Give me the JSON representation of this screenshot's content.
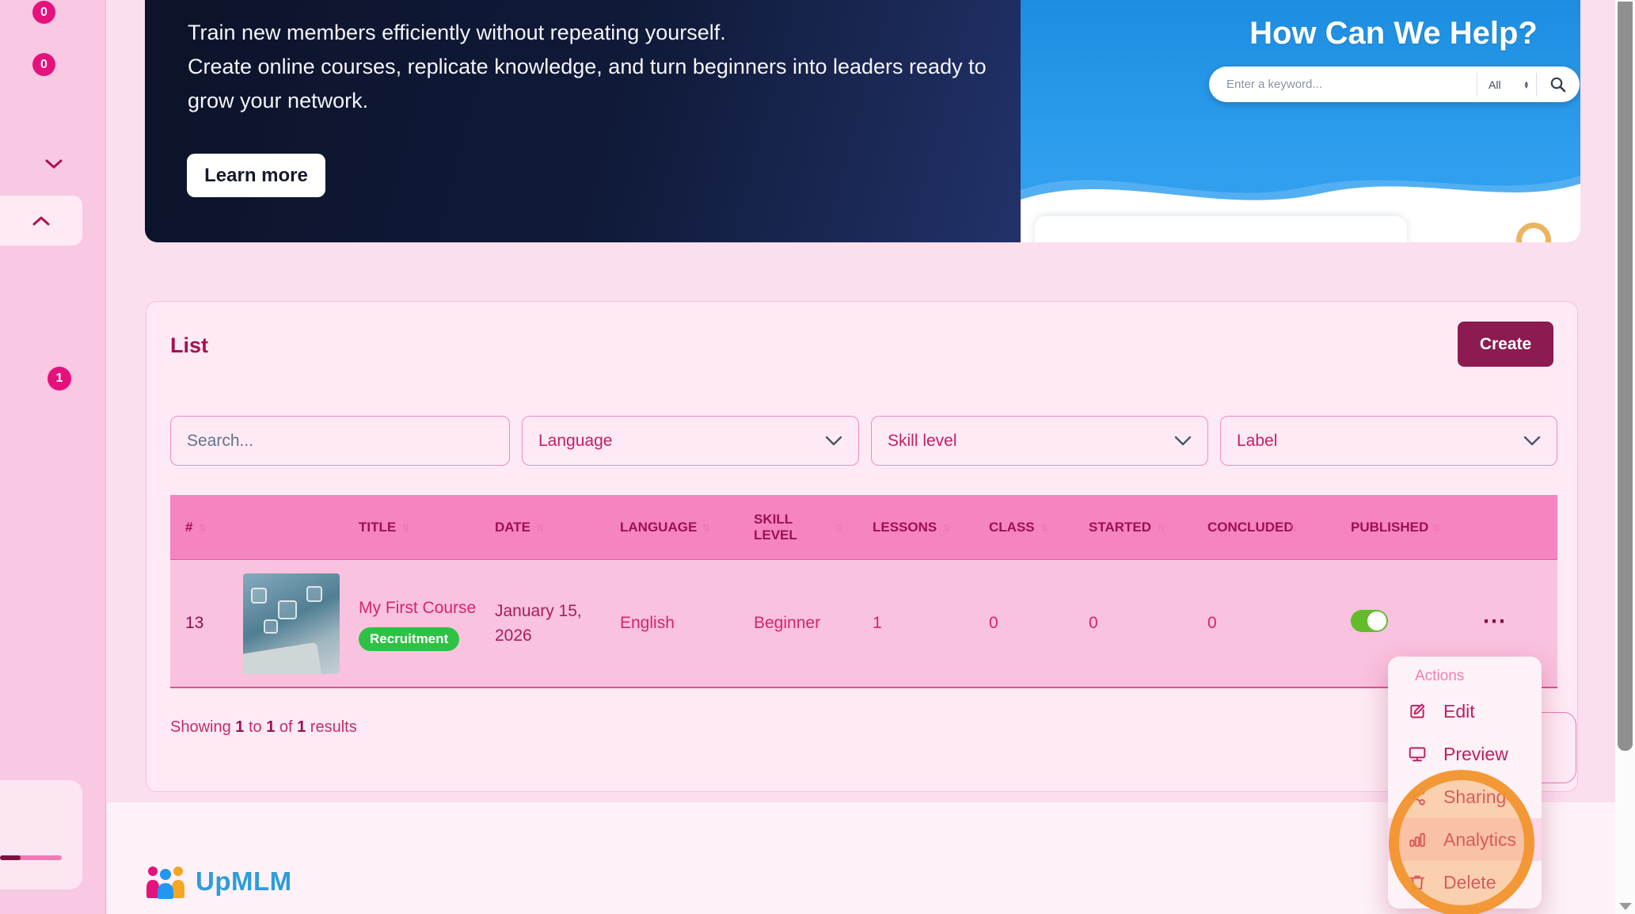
{
  "colors": {
    "accent_maroon": "#8b1b50",
    "table_header_pink": "#f584c1",
    "table_row_pink": "#f9c2de",
    "link_pink": "#d6246e",
    "badge_green": "#2fc144",
    "toggle_on_green": "#61bd29",
    "click_ring_orange": "#f2952f",
    "brand_blue": "#2d9cdb",
    "sidebar_badge_pink": "#e5127d"
  },
  "sidebar": {
    "badges": [
      "0",
      "0",
      "1"
    ]
  },
  "banner": {
    "lines": [
      "Train new members efficiently without repeating yourself.",
      "Create online courses, replicate knowledge, and turn beginners into leaders ready to",
      "grow your network."
    ],
    "learn_more_label": "Learn more",
    "help": {
      "title": "How Can We Help?",
      "search_placeholder": "Enter a keyword...",
      "category_value": "All"
    }
  },
  "list": {
    "title": "List",
    "create_label": "Create",
    "search_placeholder": "Search...",
    "filters": [
      "Language",
      "Skill level",
      "Label"
    ],
    "showing": [
      "Showing ",
      "1",
      " to ",
      "1",
      " of ",
      "1",
      " results"
    ]
  },
  "table": {
    "columns": [
      "#",
      "TITLE",
      "DATE",
      "LANGUAGE",
      "SKILL LEVEL",
      "LESSONS",
      "CLASS",
      "STARTED",
      "CONCLUDED",
      "PUBLISHED"
    ],
    "row": {
      "id": "13",
      "title": "My First Course",
      "label": "Recruitment",
      "date": "January 15, 2026",
      "language": "English",
      "skill_level": "Beginner",
      "lessons": "1",
      "class": "0",
      "started": "0",
      "concluded": "0",
      "published": true
    }
  },
  "actions_menu": {
    "header": "Actions",
    "items": [
      {
        "label": "Edit",
        "icon": "edit-icon"
      },
      {
        "label": "Preview",
        "icon": "preview-icon"
      },
      {
        "label": "Sharing",
        "icon": "sharing-icon"
      },
      {
        "label": "Analytics",
        "icon": "analytics-icon"
      },
      {
        "label": "Delete",
        "icon": "delete-icon"
      }
    ]
  },
  "footer": {
    "brand": "UpMLM"
  }
}
